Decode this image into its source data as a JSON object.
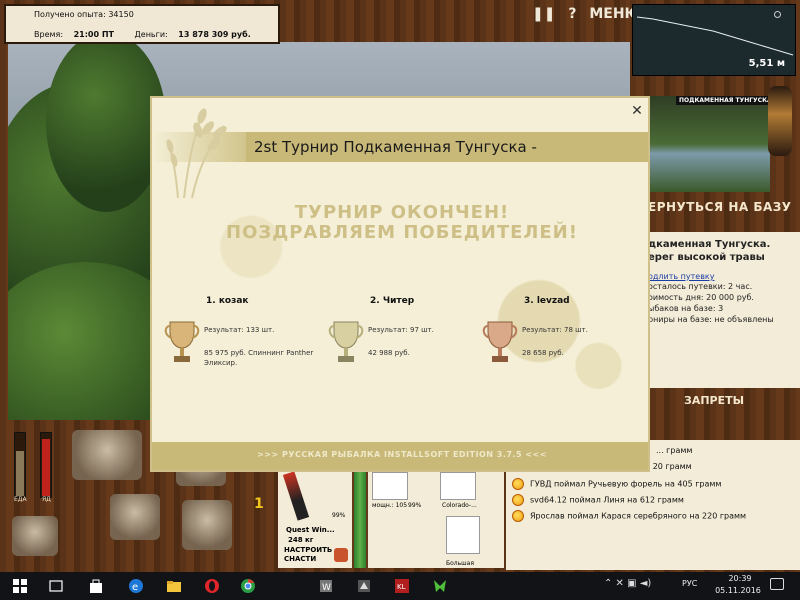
{
  "hud": {
    "experience_label": "Получено опыта:",
    "experience_value": "34150",
    "time_label": "Время:",
    "time_value": "21:00 ПТ",
    "money_label": "Деньги:",
    "money_value": "13 878 309 руб.",
    "pause_icon": "pause-icon",
    "help_label": "?",
    "menu_label": "МЕНЮ",
    "depth": "5,51 м",
    "watermark": "INSTALLSOFT"
  },
  "dialog": {
    "title": "2st Турнир Подкаменная Тунгуска -",
    "status_line1": "ТУРНИР ОКОНЧЕН!",
    "status_line2": "ПОЗДРАВЛЯЕМ ПОБЕДИТЕЛЕЙ!",
    "close_label": "✕",
    "winners": [
      {
        "place": "1. козак",
        "result": "Результат: 133 шт.",
        "prize": "85 975 руб. Спиннинг Panther Эликсир.",
        "cup": "gold"
      },
      {
        "place": "2. Читер",
        "result": "Результат: 97 шт.",
        "prize": "42 988 руб.",
        "cup": "silver"
      },
      {
        "place": "3. levzad",
        "result": "Результат: 78 шт.",
        "prize": "28 658 руб.",
        "cup": "bronze"
      }
    ],
    "footer": ">>> РУССКАЯ РЫБАЛКА INSTALLSOFT EDITION 3.7.5 <<<"
  },
  "base_panel": {
    "image_caption": "ПОДКАМЕННАЯ ТУНГУСКА",
    "return_label": "ЕРНУТЬСЯ НА БАЗУ",
    "location_line1": "дкаменная Тунгуска.",
    "location_line2": "ерег высокой травы",
    "extend_link": "одлить путевку",
    "ticket_left": "осталось путевки: 2 час.",
    "day_price": "оимость дня: 20 000 руб.",
    "fishers": "ыбаков на базе: 3",
    "tournaments": "рниры на базе: не объявлены",
    "bans_label": "ЗАПРЕТЫ"
  },
  "inventory": {
    "food_label": "ЕДА",
    "poison_label": "ЯД",
    "food_level": 0.72,
    "poison_level": 0.92,
    "slot_number": "1",
    "rod_percent": "99%",
    "rod_name": "Quest Win...",
    "rod_weight": "248 кг",
    "setup_label_1": "НАСТРОИТЬ",
    "setup_label_2": "СНАСТИ",
    "reel_label": "мощн.: 105",
    "reel_percent": "99%",
    "line_label": "Colorado-...",
    "lure_label": "Большая"
  },
  "log": [
    {
      "text": "... грамм"
    },
    {
      "text": "... рехлую на 20 грамм"
    },
    {
      "text": "ГУВД поймал Ручьевую форель на 405 грамм"
    },
    {
      "text": "svd64.12 поймал Линя на 612 грамм"
    },
    {
      "text": "Ярослав поймал Карася серебряного на 220 грамм"
    }
  ],
  "taskbar": {
    "lang": "РУС",
    "time": "20:39",
    "date": "05.11.2016",
    "icons": [
      "windows-start-icon",
      "search-icon",
      "task-view-icon",
      "store-icon",
      "edge-icon",
      "explorer-icon",
      "opera-icon",
      "chrome-icon",
      "wot-icon",
      "wows-icon",
      "klev-icon",
      "game-icon"
    ]
  },
  "colors": {
    "panel": "#f3ecd8",
    "accent_gold": "#c8b978",
    "wood": "#5a3318"
  }
}
